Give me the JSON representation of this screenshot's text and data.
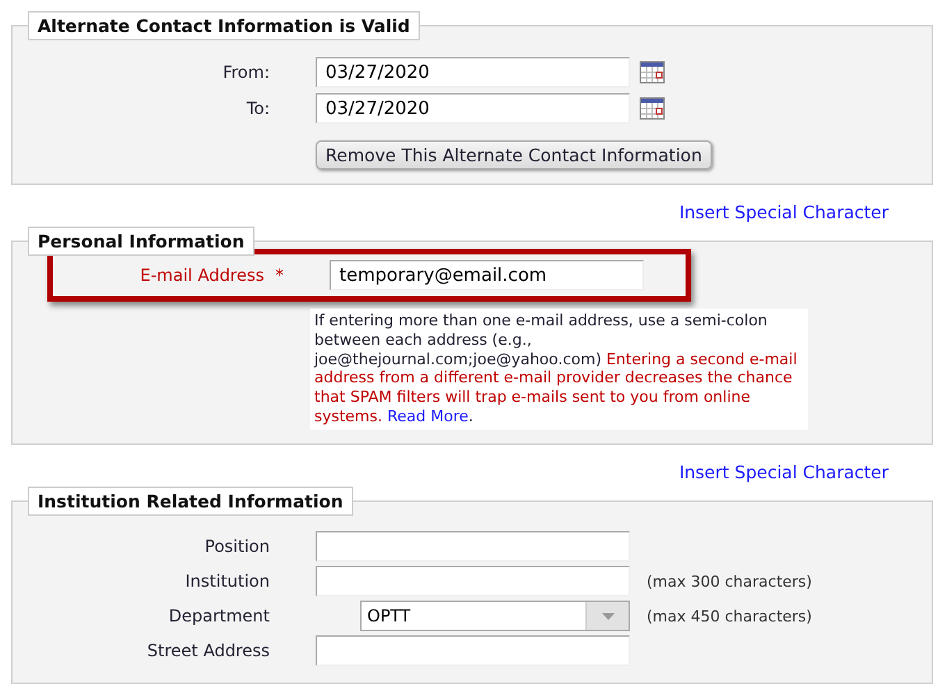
{
  "blocks": [
    {
      "kind": "section",
      "title": "Alternate Contact Information is Valid",
      "fields": [
        {
          "kind": "date",
          "label": "From:",
          "value": "03/27/2020"
        },
        {
          "kind": "date",
          "label": "To:",
          "value": "03/27/2020"
        }
      ],
      "button": "Remove This Alternate Contact Information"
    },
    {
      "kind": "link",
      "label": "Insert Special Character"
    },
    {
      "kind": "section",
      "title": "Personal Information",
      "fields": [
        {
          "kind": "text",
          "label": "E-mail Address",
          "required_mark": "*",
          "value": "temporary@email.com",
          "highlighted": true
        }
      ],
      "help": [
        {
          "kind": "plain",
          "text": "If entering more than one e-mail address, use a semi-colon between each address (e.g., joe@thejournal.com;joe@yahoo.com) "
        },
        {
          "kind": "warning",
          "text": "Entering a second e-mail address from a different e-mail provider decreases the chance that SPAM filters will trap e-mails sent to you from online systems. "
        },
        {
          "kind": "link",
          "text": "Read More"
        },
        {
          "kind": "plain",
          "text": "."
        }
      ]
    },
    {
      "kind": "link",
      "label": "Insert Special Character"
    },
    {
      "kind": "section",
      "title": "Institution Related Information",
      "fields": [
        {
          "kind": "text",
          "label": "Position"
        },
        {
          "kind": "text",
          "label": "Institution",
          "note": "(max 300 characters)"
        },
        {
          "kind": "select",
          "label": "Department",
          "value": "OPTT",
          "note": "(max 450 characters)"
        },
        {
          "kind": "text",
          "label": "Street Address"
        }
      ]
    }
  ]
}
